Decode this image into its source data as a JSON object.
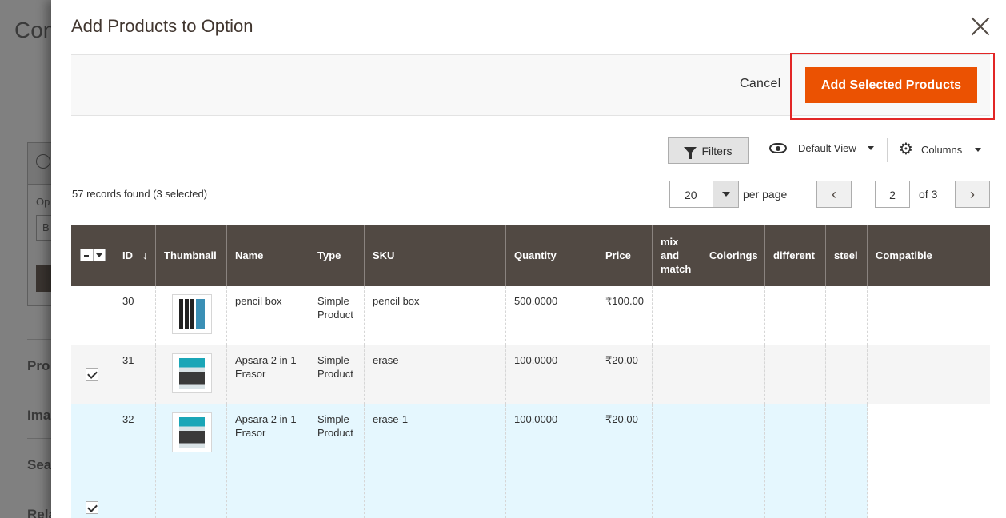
{
  "background": {
    "title_fragment": "Con",
    "label_fragment": "Op",
    "input_fragment": "B",
    "nav": [
      "Pro",
      "Ima",
      "Sea",
      "Rela"
    ]
  },
  "modal": {
    "title": "Add Products to Option",
    "cancel_label": "Cancel",
    "add_label": "Add Selected Products"
  },
  "toolbar": {
    "filters_label": "Filters",
    "view_label": "Default View",
    "columns_label": "Columns",
    "records_text": "57 records found (3 selected)",
    "per_page_value": "20",
    "per_page_label": "per page",
    "page_value": "2",
    "page_of": "of 3",
    "prev_icon": "‹",
    "next_icon": "›"
  },
  "grid": {
    "columns": [
      "ID",
      "Thumbnail",
      "Name",
      "Type",
      "SKU",
      "Quantity",
      "Price",
      "mix and match",
      "Colorings",
      "different",
      "steel",
      "Compatible"
    ],
    "sort_arrow": "↓",
    "rows": [
      {
        "id": "30",
        "name": "pencil box",
        "type": "Simple Product",
        "sku": "pencil box",
        "qty": "500.0000",
        "price": "₹100.00",
        "checked": false,
        "thumb_color": "#2a2a2a"
      },
      {
        "id": "31",
        "name": "Apsara 2 in 1 Erasor",
        "type": "Simple Product",
        "sku": "erase",
        "qty": "100.0000",
        "price": "₹20.00",
        "checked": true,
        "thumb_color": "#1aa6b7"
      },
      {
        "id": "32",
        "name": "Apsara 2 in 1 Erasor",
        "type": "Simple Product",
        "sku": "erase-1",
        "qty": "100.0000",
        "price": "₹20.00",
        "checked": true,
        "thumb_color": "#1aa6b7"
      }
    ]
  },
  "colors": {
    "accent": "#eb5202",
    "header_bg": "#514943",
    "highlight_border": "#e22626",
    "selected_row": "#e5f7fe",
    "alt_row": "#f5f5f5"
  }
}
